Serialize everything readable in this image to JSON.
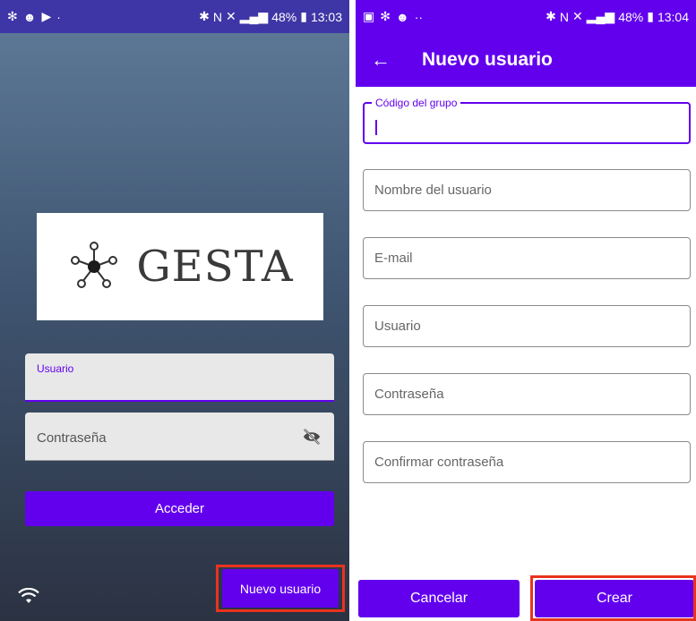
{
  "left": {
    "status": {
      "battery": "48%",
      "time": "13:03"
    },
    "logo": {
      "text": "GESTA"
    },
    "user_field": {
      "label": "Usuario"
    },
    "password_field": {
      "label": "Contraseña"
    },
    "login_button": "Acceder",
    "new_user_button": "Nuevo usuario"
  },
  "right": {
    "status": {
      "battery": "48%",
      "time": "13:04"
    },
    "appbar": {
      "title": "Nuevo usuario"
    },
    "fields": {
      "group_code": "Código del grupo",
      "user_name": "Nombre del usuario",
      "email": "E-mail",
      "username": "Usuario",
      "password": "Contraseña",
      "confirm_password": "Confirmar contraseña"
    },
    "cancel_button": "Cancelar",
    "create_button": "Crear"
  },
  "colors": {
    "accent": "#6200ee",
    "highlight_frame": "#e8331f",
    "status_left": "#3e36a6"
  }
}
